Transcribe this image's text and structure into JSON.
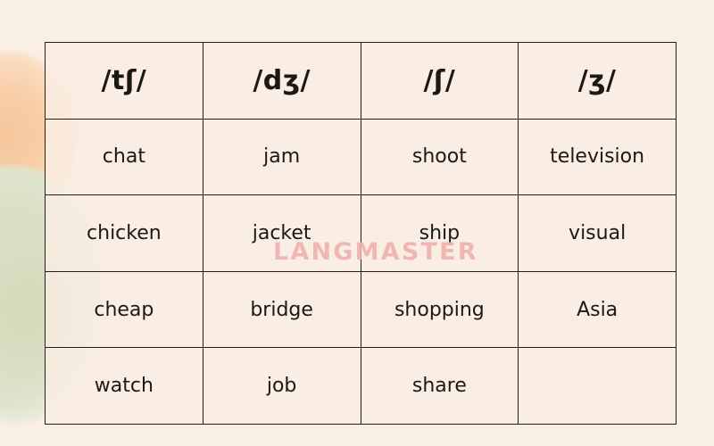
{
  "background": {
    "page_color": "#faefe4",
    "blob_orange_color": "#f6c69b",
    "blob_green_color": "#d5dcbe"
  },
  "watermark": {
    "text": "LANGMASTER",
    "color": "#f0b3ae"
  },
  "table": {
    "border_color": "#23201c",
    "headers": [
      {
        "symbol": "/tʃ/"
      },
      {
        "symbol": "/dʒ/"
      },
      {
        "symbol": "/ʃ/"
      },
      {
        "symbol": "/ʒ/"
      }
    ],
    "rows": [
      {
        "cells": [
          "chat",
          "jam",
          "shoot",
          "television"
        ]
      },
      {
        "cells": [
          "chicken",
          "jacket",
          "ship",
          "visual"
        ]
      },
      {
        "cells": [
          "cheap",
          "bridge",
          "shopping",
          "Asia"
        ]
      },
      {
        "cells": [
          "watch",
          "job",
          "share",
          ""
        ]
      }
    ]
  }
}
